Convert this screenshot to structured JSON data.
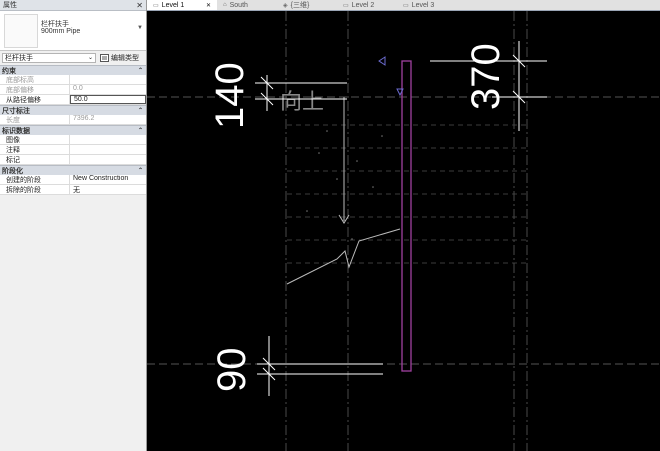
{
  "properties": {
    "title": "属性",
    "type_line1": "栏杆扶手",
    "type_line2": "900mm Pipe",
    "selector_value": "栏杆扶手",
    "edit_type_label": "编辑类型",
    "groups": [
      {
        "name": "约束",
        "rows": [
          {
            "key": "底部标高",
            "value": "",
            "disabled": true
          },
          {
            "key": "底部偏移",
            "value": "0.0",
            "disabled": true
          },
          {
            "key": "从路径偏移",
            "value": "50.0",
            "disabled": false,
            "active": true
          }
        ]
      },
      {
        "name": "尺寸标注",
        "rows": [
          {
            "key": "长度",
            "value": "7396.2",
            "disabled": true
          }
        ]
      },
      {
        "name": "标识数据",
        "rows": [
          {
            "key": "图像",
            "value": "",
            "disabled": false
          },
          {
            "key": "注释",
            "value": "",
            "disabled": false
          },
          {
            "key": "标记",
            "value": "",
            "disabled": false
          }
        ]
      },
      {
        "name": "阶段化",
        "rows": [
          {
            "key": "创建的阶段",
            "value": "New Construction",
            "disabled": false
          },
          {
            "key": "拆除的阶段",
            "value": "无",
            "disabled": false
          }
        ]
      }
    ]
  },
  "tabs": [
    {
      "label": "Level 1",
      "active": true,
      "icon": "floor-plan-icon"
    },
    {
      "label": "South",
      "active": false,
      "icon": "elevation-icon"
    },
    {
      "label": "{三维}",
      "active": false,
      "icon": "3d-view-icon"
    },
    {
      "label": "Level 2",
      "active": false,
      "icon": "floor-plan-icon"
    },
    {
      "label": "Level 3",
      "active": false,
      "icon": "floor-plan-icon"
    }
  ],
  "drawing": {
    "dimensions": {
      "left_top": "140",
      "left_bottom": "90",
      "right_top": "370"
    },
    "stair_label": "向上"
  }
}
